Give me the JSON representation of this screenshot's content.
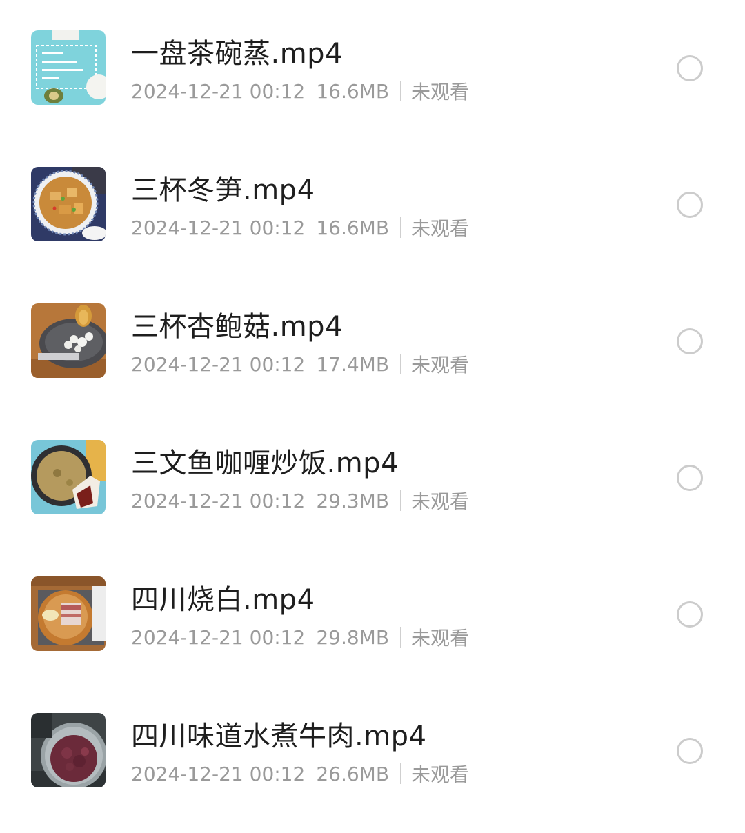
{
  "files": [
    {
      "name": "一盘茶碗蒸.mp4",
      "date": "2024-12-21 00:12",
      "size": "16.6MB",
      "status": "未观看",
      "thumbnail_icon": "video-thumbnail-chawanmushi"
    },
    {
      "name": "三杯冬笋.mp4",
      "date": "2024-12-21 00:12",
      "size": "16.6MB",
      "status": "未观看",
      "thumbnail_icon": "video-thumbnail-bamboo-shoots"
    },
    {
      "name": "三杯杏鲍菇.mp4",
      "date": "2024-12-21 00:12",
      "size": "17.4MB",
      "status": "未观看",
      "thumbnail_icon": "video-thumbnail-mushroom-wok"
    },
    {
      "name": "三文鱼咖喱炒饭.mp4",
      "date": "2024-12-21 00:12",
      "size": "29.3MB",
      "status": "未观看",
      "thumbnail_icon": "video-thumbnail-curry-pan"
    },
    {
      "name": "四川烧白.mp4",
      "date": "2024-12-21 00:12",
      "size": "29.8MB",
      "status": "未观看",
      "thumbnail_icon": "video-thumbnail-pork-bowl"
    },
    {
      "name": "四川味道水煮牛肉.mp4",
      "date": "2024-12-21 00:12",
      "size": "26.6MB",
      "status": "未观看",
      "thumbnail_icon": "video-thumbnail-beef-bowl"
    }
  ],
  "colors": {
    "title_text": "#1e1e1e",
    "meta_text": "#9a9a9a",
    "separator": "#cfcfcf",
    "radio_border": "#cccccc",
    "background": "#ffffff"
  }
}
